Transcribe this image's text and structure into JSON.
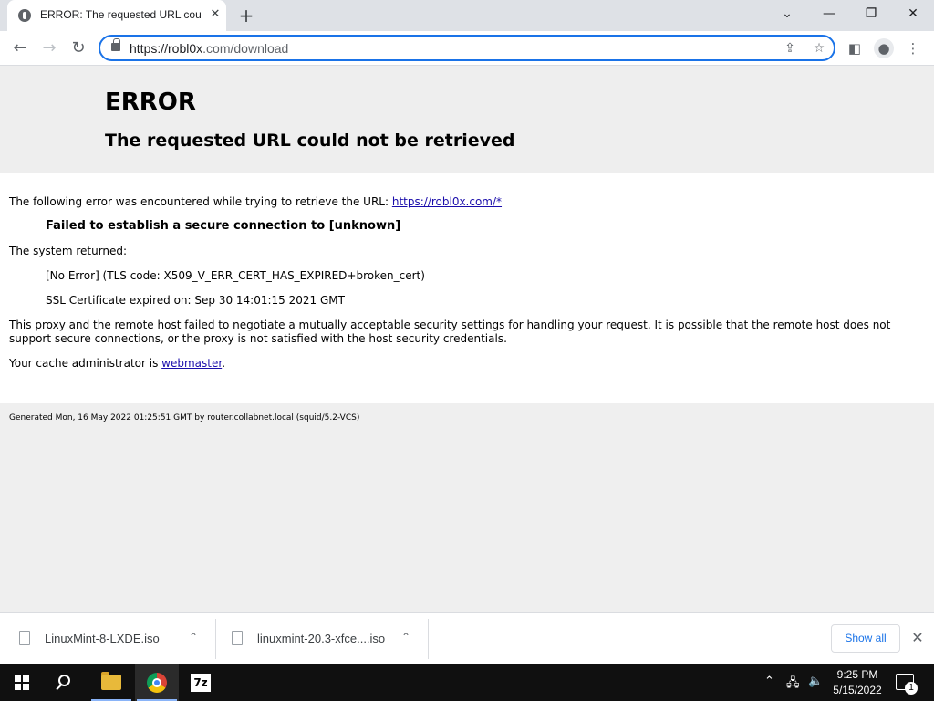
{
  "browser": {
    "tab_title": "ERROR: The requested URL could not be retrieved",
    "url_host": "https://robl0x",
    "url_rest": ".com/download"
  },
  "page": {
    "heading": "ERROR",
    "subheading": "The requested URL could not be retrieved",
    "intro_text": "The following error was encountered while trying to retrieve the URL: ",
    "intro_link": "https://robl0x.com/*",
    "failure": "Failed to establish a secure connection to [unknown]",
    "system_returned": "The system returned:",
    "tls_error": "[No Error] (TLS code: X509_V_ERR_CERT_HAS_EXPIRED+broken_cert)",
    "ssl_expired": "SSL Certificate expired on: Sep 30 14:01:15 2021 GMT",
    "explanation_1": "This proxy and the remote host failed to negotiate a mutually acceptable security settings for handling your request. It is possible that the remote host does not",
    "explanation_2": "support secure connections, or the proxy is not satisfied with the host security credentials.",
    "admin_text": "Your cache administrator is ",
    "admin_link": "webmaster",
    "admin_end": ".",
    "footer": "Generated Mon, 16 May 2022 01:25:51 GMT by router.collabnet.local (squid/5.2-VCS)"
  },
  "downloads": {
    "items": [
      {
        "name": "LinuxMint-8-LXDE.iso"
      },
      {
        "name": "linuxmint-20.3-xfce....iso"
      }
    ],
    "show_all": "Show all"
  },
  "taskbar": {
    "sevenzip_label": "7z",
    "time": "9:25 PM",
    "date": "5/15/2022",
    "notification_count": "1"
  },
  "icons": {
    "tab_favicon": "globe-icon",
    "close": "close-icon",
    "new_tab": "plus-icon",
    "minimize": "minimize-icon",
    "maximize": "restore-icon",
    "back": "back-arrow-icon",
    "forward": "forward-arrow-icon",
    "reload": "reload-icon",
    "lock": "lock-icon",
    "share": "share-icon",
    "bookmark": "star-icon",
    "side_panel": "side-panel-icon",
    "profile": "profile-icon",
    "menu": "kebab-menu-icon"
  },
  "colors": {
    "omnibox_border": "#1a73e8",
    "link": "#1a0dab",
    "page_bg": "#efefef",
    "taskbar_bg": "#101010"
  }
}
